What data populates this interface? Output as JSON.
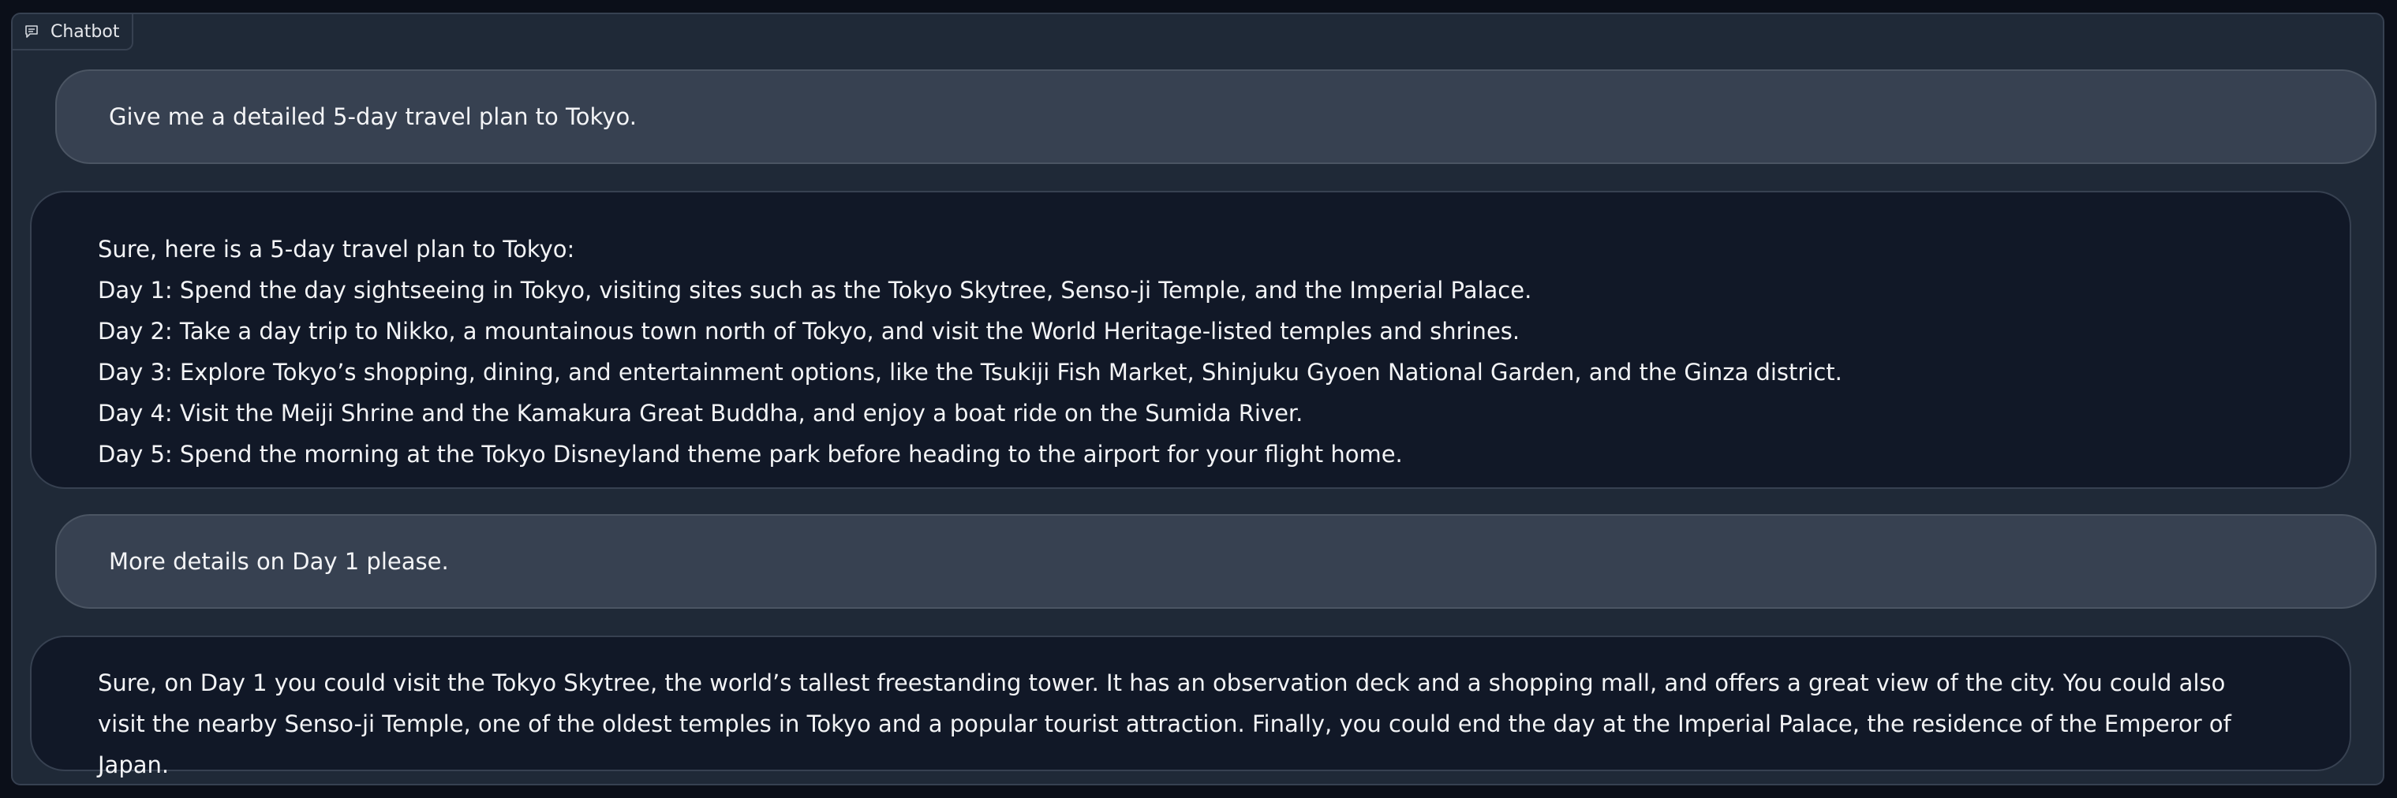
{
  "chatbot": {
    "label": "Chatbot",
    "icon": "chat-icon"
  },
  "messages": [
    {
      "role": "user",
      "text": "Give me a detailed 5-day travel plan to Tokyo."
    },
    {
      "role": "bot",
      "lines": [
        "Sure, here is a 5-day travel plan to Tokyo:",
        "Day 1: Spend the day sightseeing in Tokyo, visiting sites such as the Tokyo Skytree, Senso-ji Temple, and the Imperial Palace.",
        "Day 2: Take a day trip to Nikko, a mountainous town north of Tokyo, and visit the World Heritage-listed temples and shrines.",
        "Day 3: Explore Tokyo’s shopping, dining, and entertainment options, like the Tsukiji Fish Market, Shinjuku Gyoen National Garden, and the Ginza district.",
        "Day 4: Visit the Meiji Shrine and the Kamakura Great Buddha, and enjoy a boat ride on the Sumida River.",
        "Day 5: Spend the morning at the Tokyo Disneyland theme park before heading to the airport for your flight home."
      ]
    },
    {
      "role": "user",
      "text": "More details on Day 1 please."
    },
    {
      "role": "bot",
      "text": "Sure, on Day 1 you could visit the Tokyo Skytree, the world’s tallest freestanding tower. It has an observation deck and a shopping mall, and offers a great view of the city. You could also visit the nearby Senso-ji Temple, one of the oldest temples in Tokyo and a popular tourist attraction. Finally, you could end the day at the Imperial Palace, the residence of the Emperor of Japan."
    }
  ],
  "colors": {
    "page_background": "#0b0f19",
    "panel_background": "#1f2937",
    "user_bubble": "#374151",
    "bot_bubble": "#111827",
    "text": "#f3f4f6"
  }
}
